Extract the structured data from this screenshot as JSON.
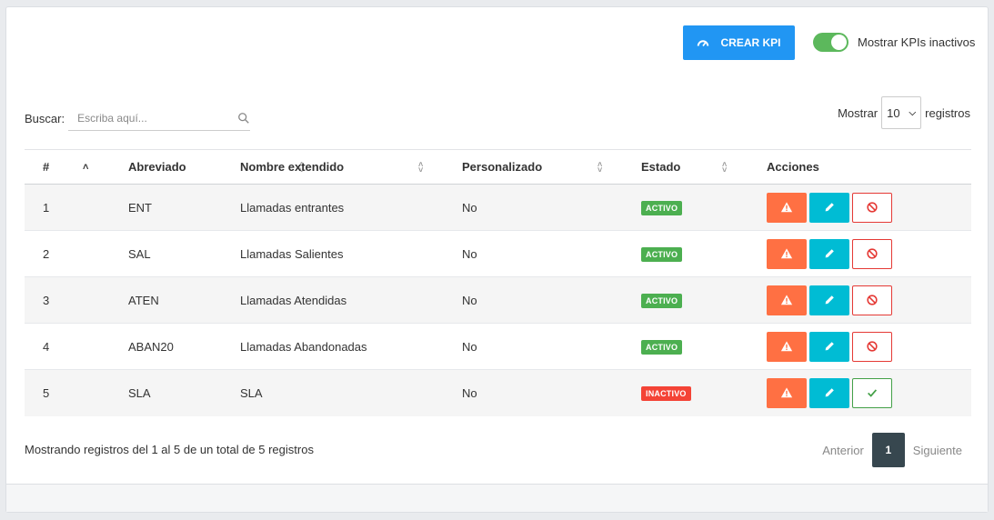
{
  "toolbar": {
    "create_label": "CREAR KPI",
    "toggle_label": "Mostrar KPIs inactivos",
    "toggle_on": true
  },
  "search": {
    "label": "Buscar:",
    "placeholder": "Escriba aquí..."
  },
  "length": {
    "prefix": "Mostrar",
    "value": "10",
    "suffix": "registros"
  },
  "table": {
    "columns": [
      "#",
      "Abreviado",
      "Nombre extendido",
      "Personalizado",
      "Estado",
      "Acciones"
    ],
    "rows": [
      {
        "num": "1",
        "abbr": "ENT",
        "name": "Llamadas entrantes",
        "custom": "No",
        "status": "ACTIVO",
        "active": true
      },
      {
        "num": "2",
        "abbr": "SAL",
        "name": "Llamadas Salientes",
        "custom": "No",
        "status": "ACTIVO",
        "active": true
      },
      {
        "num": "3",
        "abbr": "ATEN",
        "name": "Llamadas Atendidas",
        "custom": "No",
        "status": "ACTIVO",
        "active": true
      },
      {
        "num": "4",
        "abbr": "ABAN20",
        "name": "Llamadas Abandonadas",
        "custom": "No",
        "status": "ACTIVO",
        "active": true
      },
      {
        "num": "5",
        "abbr": "SLA",
        "name": "SLA",
        "custom": "No",
        "status": "INACTIVO",
        "active": false
      }
    ]
  },
  "footer": {
    "info": "Mostrando registros del 1 al 5 de un total de 5 registros",
    "prev": "Anterior",
    "current_page": "1",
    "next": "Siguiente"
  },
  "colors": {
    "primary": "#2196f3",
    "toggle": "#5cb85c",
    "warn": "#ff7043",
    "edit": "#00bcd4",
    "active_badge": "#4caf50",
    "inactive_badge": "#f44336",
    "pager_current": "#37474f"
  },
  "icons": [
    "speedometer-icon",
    "search-icon",
    "warning-icon",
    "pencil-icon",
    "block-icon",
    "check-icon"
  ]
}
